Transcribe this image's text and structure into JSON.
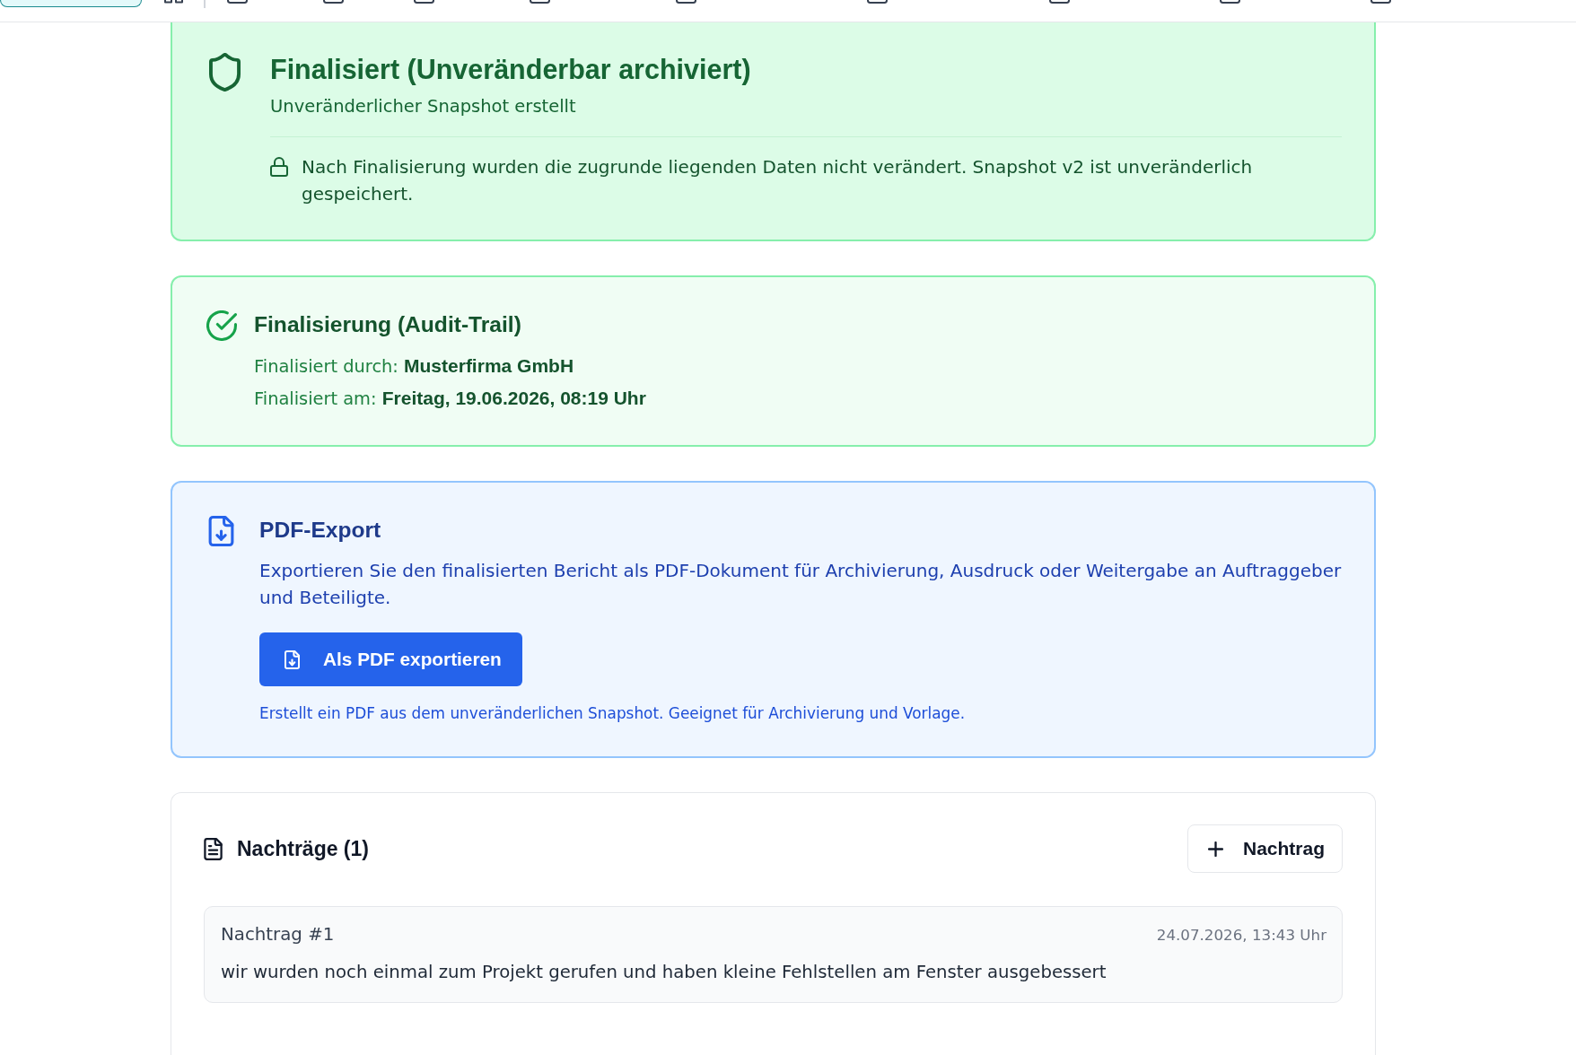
{
  "top_nav": {
    "tabs": [
      {
        "selected": true
      },
      {
        "selected": false
      },
      {
        "selected": false
      },
      {
        "selected": false
      },
      {
        "selected": false
      },
      {
        "selected": false
      },
      {
        "selected": false
      },
      {
        "selected": false
      },
      {
        "selected": false
      },
      {
        "selected": false
      }
    ]
  },
  "status_card": {
    "title": "Finalisiert (Unveränderbar archiviert)",
    "subtitle": "Unveränderlicher Snapshot erstellt",
    "note": "Nach Finalisierung wurden die zugrunde liegenden Daten nicht verändert. Snapshot v2 ist unveränderlich gespeichert."
  },
  "audit_card": {
    "title": "Finalisierung (Audit-Trail)",
    "fields": [
      {
        "label": "Finalisiert durch:",
        "value": "Musterfirma GmbH"
      },
      {
        "label": "Finalisiert am:",
        "value": "Freitag, 19.06.2026, 08:19 Uhr"
      }
    ]
  },
  "pdf_export": {
    "title": "PDF-Export",
    "description": "Exportieren Sie den finalisierten Bericht als PDF-Dokument für Archivierung, Ausdruck oder Weitergabe an Auftraggeber und Beteiligte.",
    "button": "Als PDF exportieren",
    "note": "Erstellt ein PDF aus dem unveränderlichen Snapshot. Geeignet für Archivierung und Vorlage."
  },
  "addenda": {
    "title": "Nachträge (1)",
    "add_button": "Nachtrag",
    "entries": [
      {
        "title": "Nachtrag #1",
        "date": "24.07.2026, 13:43 Uhr",
        "text": "wir wurden noch einmal zum Projekt gerufen und haben kleine Fehlstellen am Fenster ausgebessert"
      }
    ]
  }
}
